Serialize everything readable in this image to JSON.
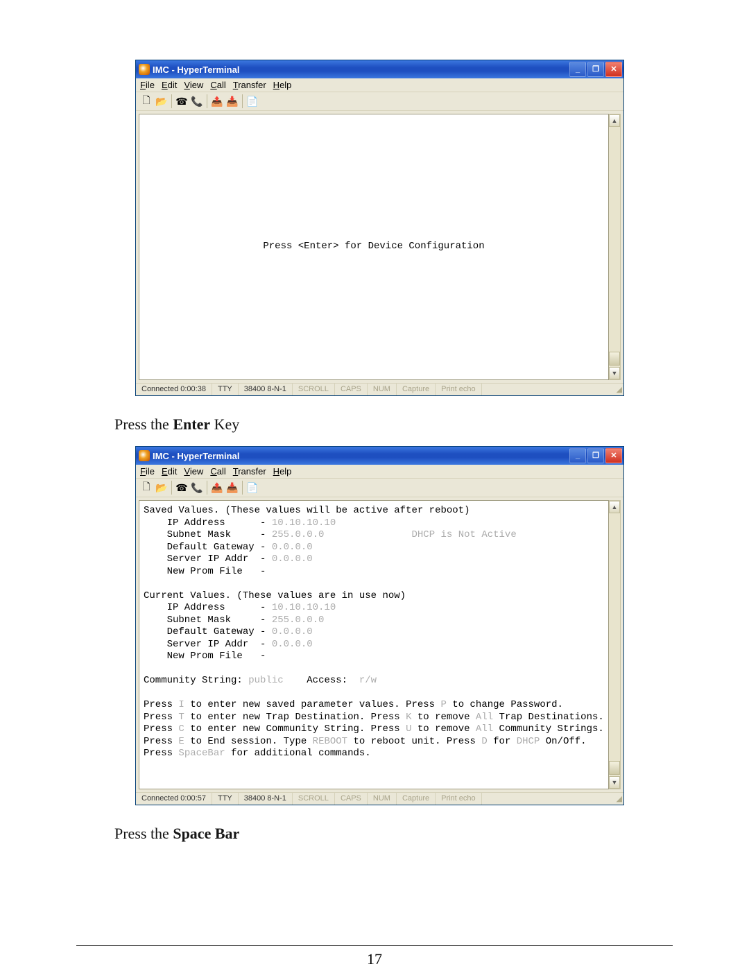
{
  "window": {
    "title": "IMC - HyperTerminal",
    "menus": {
      "file": "File",
      "edit": "Edit",
      "view": "View",
      "call": "Call",
      "transfer": "Transfer",
      "help": "Help"
    }
  },
  "toolbar_icons": {
    "new": "🗋",
    "open": "📂",
    "dial": "☎",
    "hangup": "📞",
    "send": "📤",
    "receive": "📥",
    "props": "📄"
  },
  "screenshot1": {
    "terminal_line": "Press <Enter> for Device Configuration",
    "status": {
      "connected": "Connected 0:00:38",
      "mode": "TTY",
      "settings": "38400 8-N-1",
      "scroll": "SCROLL",
      "caps": "CAPS",
      "num": "NUM",
      "capture": "Capture",
      "echo": "Print echo"
    }
  },
  "caption1": {
    "prefix": "Press the ",
    "bold": "Enter",
    "suffix": " Key"
  },
  "screenshot2": {
    "saved": {
      "header": "Saved Values. (These values will be active after reboot)",
      "ip_label": "IP Address",
      "ip_val": "10.10.10.10",
      "mask_label": "Subnet Mask",
      "mask_val": "255.0.0.0",
      "gw_label": "Default Gateway",
      "gw_val": "0.0.0.0",
      "srv_label": "Server IP Addr",
      "srv_val": "0.0.0.0",
      "prom_label": "New Prom File",
      "dhcp_note": "DHCP is Not Active"
    },
    "current": {
      "header": "Current Values. (These values are in use now)",
      "ip_label": "IP Address",
      "ip_val": "10.10.10.10",
      "mask_label": "Subnet Mask",
      "mask_val": "255.0.0.0",
      "gw_label": "Default Gateway",
      "gw_val": "0.0.0.0",
      "srv_label": "Server IP Addr",
      "srv_val": "0.0.0.0",
      "prom_label": "New Prom File"
    },
    "community": {
      "label": "Community String:",
      "value": "public",
      "access_label": "Access:",
      "access_value": "r/w"
    },
    "help": {
      "l1a": "Press ",
      "l1k1": "I",
      "l1b": " to enter new saved parameter values. Press ",
      "l1k2": "P",
      "l1c": " to change Password.",
      "l2a": "Press ",
      "l2k1": "T",
      "l2b": " to enter new Trap Destination. Press ",
      "l2k2": "K",
      "l2c": " to remove ",
      "l2g": "All",
      "l2d": " Trap Destinations.",
      "l3a": "Press ",
      "l3k1": "C",
      "l3b": " to enter new Community String. Press ",
      "l3k2": "U",
      "l3c": " to remove ",
      "l3g": "All",
      "l3d": " Community Strings.",
      "l4a": "Press ",
      "l4k1": "E",
      "l4b": " to End session. Type ",
      "l4k2": "REBOOT",
      "l4c": " to reboot unit. Press ",
      "l4k3": "D",
      "l4d": " for ",
      "l4g": "DHCP",
      "l4e": " On/Off.",
      "l5a": "Press ",
      "l5k1": "SpaceBar",
      "l5b": " for additional commands."
    },
    "status": {
      "connected": "Connected 0:00:57",
      "mode": "TTY",
      "settings": "38400 8-N-1",
      "scroll": "SCROLL",
      "caps": "CAPS",
      "num": "NUM",
      "capture": "Capture",
      "echo": "Print echo"
    }
  },
  "caption2": {
    "prefix": "Press the ",
    "bold": "Space Bar"
  },
  "page_number": "17"
}
